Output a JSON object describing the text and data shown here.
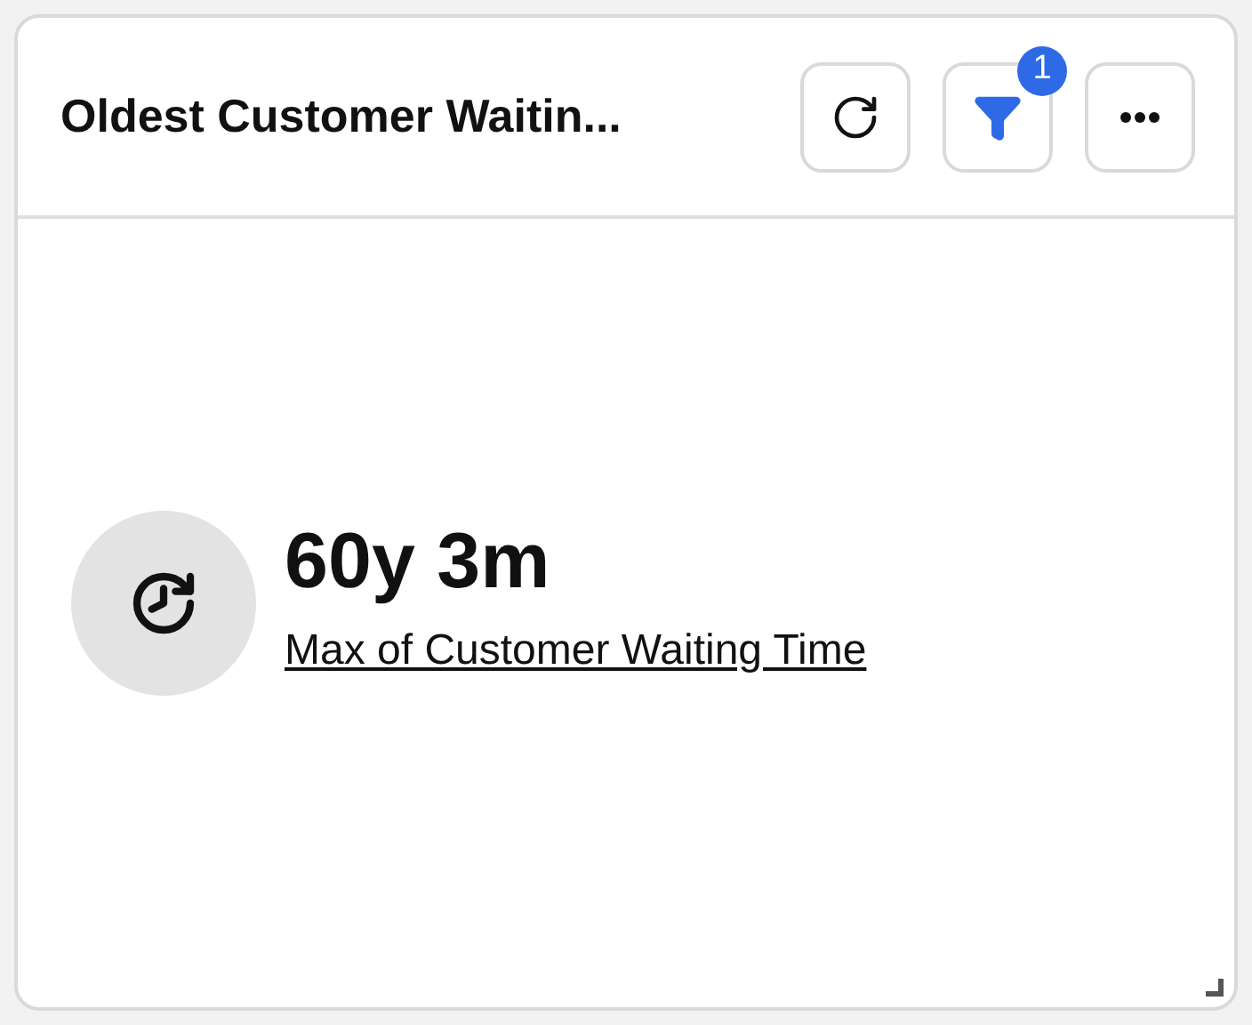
{
  "card": {
    "title": "Oldest Customer Waitin..."
  },
  "toolbar": [
    {
      "kind": "refresh",
      "active": false
    },
    {
      "kind": "filter",
      "active": true,
      "badge": "1"
    },
    {
      "kind": "more",
      "active": false
    }
  ],
  "metric": {
    "value": "60y 3m",
    "label": "Max of Customer Waiting Time"
  }
}
